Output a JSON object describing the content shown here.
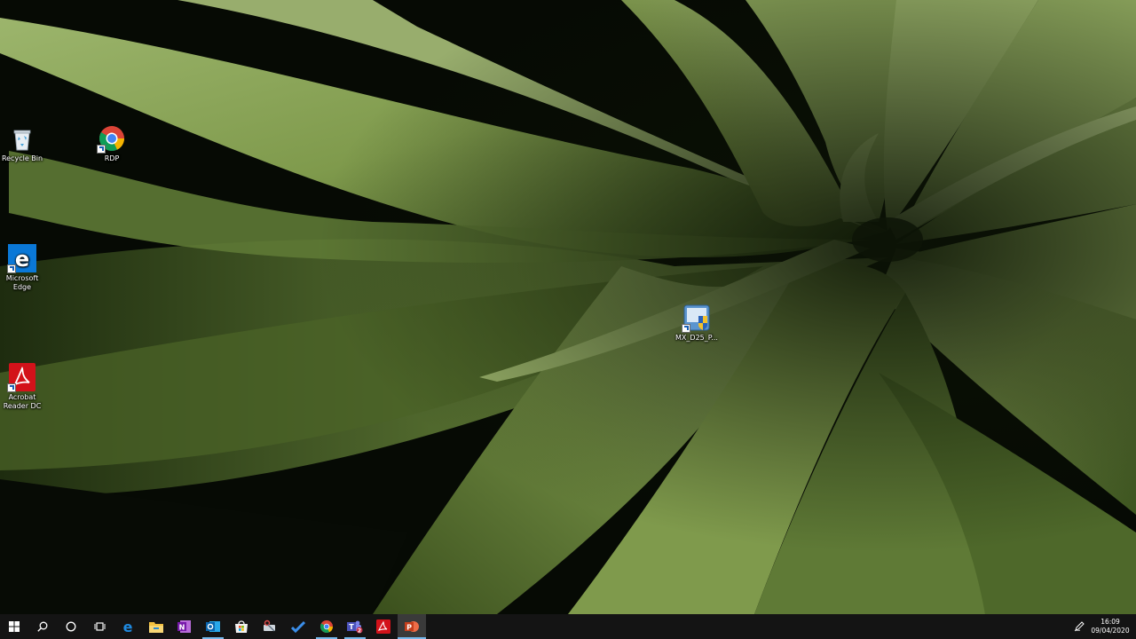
{
  "desktop": {
    "icons": [
      {
        "label": "Recycle Bin"
      },
      {
        "label": "RDP"
      },
      {
        "label": "Microsoft Edge"
      },
      {
        "label": "Acrobat Reader DC"
      },
      {
        "label": "MX_D25_P..."
      }
    ]
  },
  "taskbar": {
    "buttons": [
      {
        "icon": "windows-start-icon"
      },
      {
        "icon": "search-icon"
      },
      {
        "icon": "cortana-icon"
      },
      {
        "icon": "task-view-icon"
      },
      {
        "icon": "edge-icon"
      },
      {
        "icon": "file-explorer-icon"
      },
      {
        "icon": "onenote-icon"
      },
      {
        "icon": "outlook-icon"
      },
      {
        "icon": "microsoft-store-icon"
      },
      {
        "icon": "snipping-tool-icon"
      },
      {
        "icon": "to-do-icon"
      },
      {
        "icon": "chrome-icon"
      },
      {
        "icon": "teams-icon",
        "badge": "2"
      },
      {
        "icon": "acrobat-icon"
      },
      {
        "icon": "powerpoint-icon"
      }
    ],
    "tray": {
      "time": "16:09",
      "date": "09/04/2020"
    }
  },
  "colors": {
    "taskbar_bg": "#141414",
    "running_indicator": "#76b9ed",
    "leaf_green": "#7a9448"
  }
}
